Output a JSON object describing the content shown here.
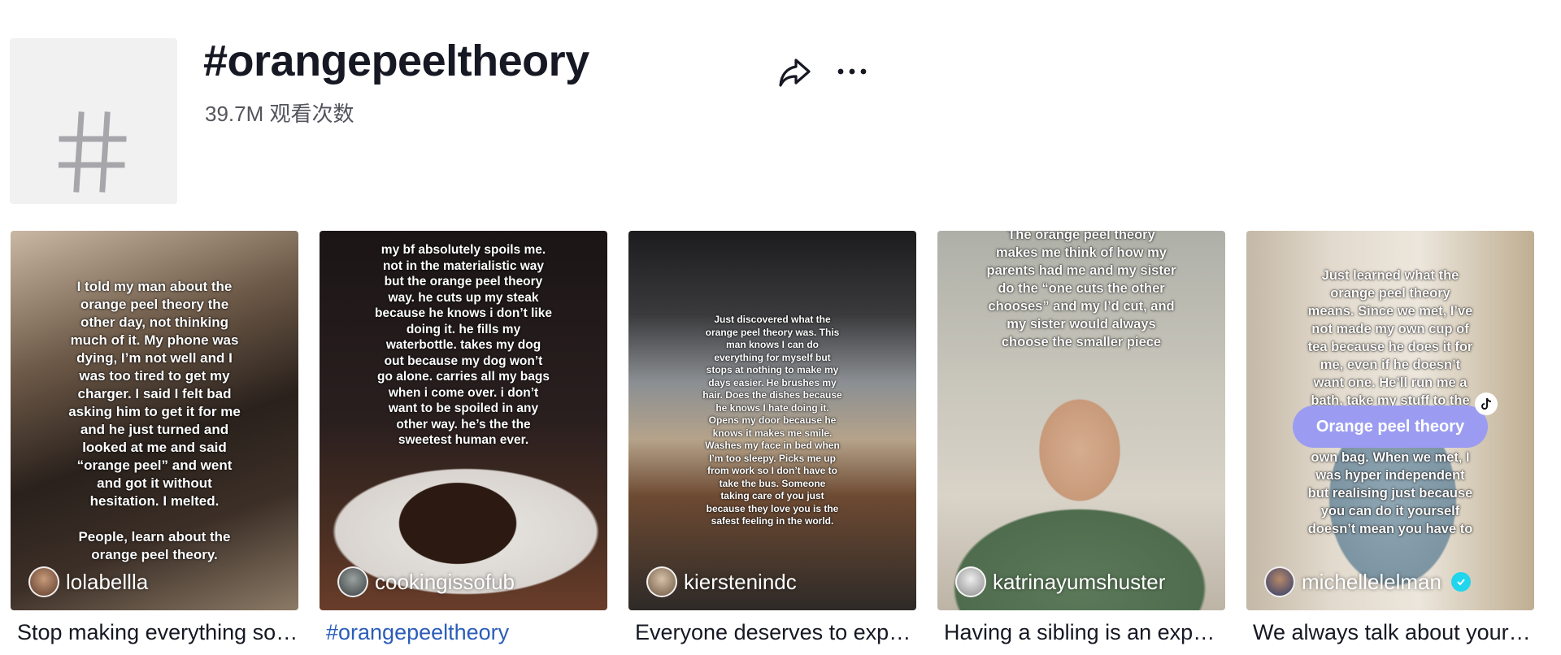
{
  "tag": {
    "title": "#orangepeeltheory",
    "views": "39.7M 观看次数",
    "icon": "hashtag-icon"
  },
  "actions": {
    "share_icon": "share-icon",
    "more_icon": "more-icon"
  },
  "videos": [
    {
      "overlay": "I told my man about the\norange peel theory the\nother day, not thinking\nmuch of it. My phone was\ndying, I’m not well and I\nwas too tired to get my\ncharger. I said I felt bad\nasking him to get it for me\nand he just turned and\nlooked at me and said\n“orange peel” and went\nand got it without\nhesitation. I melted.\n\nPeople, learn about the\norange peel theory.",
      "author": "lolabellla",
      "caption": "Stop making everything so complicated"
    },
    {
      "overlay": "my bf absolutely spoils me.\nnot in the materialistic way\nbut the orange peel theory\nway. he cuts up my steak\nbecause he knows i don’t like\ndoing it. he fills my\nwaterbottle. takes my dog\nout because my dog won’t\ngo alone. carries all my bags\nwhen i come over. i don’t\nwant to be spoiled in any\nother way. he’s the the\nsweetest human ever.",
      "author": "cookingissofub",
      "caption": "#orangepeeltheory"
    },
    {
      "overlay": "Just discovered what the\norange peel theory was. This\nman knows I can do\neverything for myself but\nstops at nothing to make my\ndays easier. He brushes my\nhair. Does the dishes because\nhe knows I hate doing it.\nOpens my door because he\nknows it makes me smile.\nWashes my face in bed when\nI’m too sleepy. Picks me up\nfrom work so I don’t have to\ntake the bus. Someone\ntaking care of you just\nbecause they love you is the\nsafest feeling in the world.",
      "author": "kierstenindc",
      "caption": "Everyone deserves to experience this"
    },
    {
      "overlay": "The orange peel theory\nmakes me think of how my\nparents had me and my sister\ndo the “one cuts the other\nchooses” and my I’d cut, and\nmy sister would always\nchoose the smaller piece",
      "author": "katrinayumshuster",
      "caption": "Having a sibling is an experience"
    },
    {
      "overlay_top": "Just learned what the\norange peel theory\nmeans. Since we met, I’ve\nnot made my own cup of\ntea because he does it for\nme, even if he doesn’t\nwant one. He’ll run me a\nbath, take my stuff to the",
      "pill": "Orange peel theory",
      "overlay_bottom": "own bag. When we met, I\nwas hyper independent\nbut realising just because\nyou can do it yourself\ndoesn’t mean you have to",
      "author": "michellelelman",
      "caption": "We always talk about your health"
    }
  ],
  "colors": {
    "link": "#2b5db9",
    "text": "#161823",
    "secondary": "#54555c",
    "pill": "#9b9cf1",
    "verified": "#20d5ec"
  }
}
